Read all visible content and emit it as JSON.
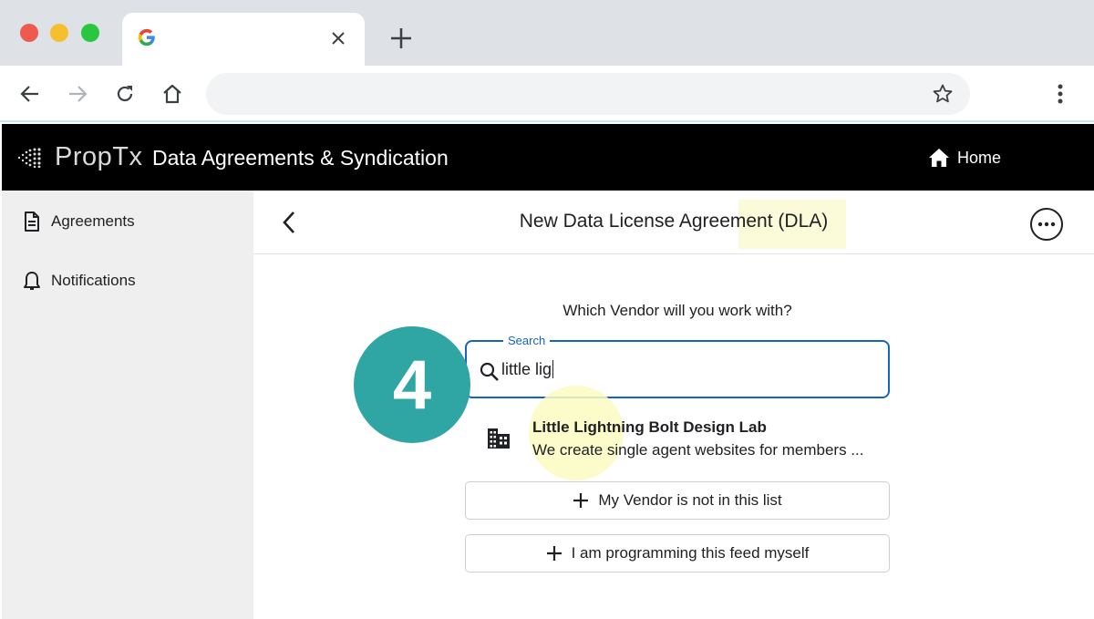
{
  "browser": {
    "tab": {
      "title": "",
      "favicon": "google-g-icon"
    },
    "address": {
      "value": ""
    }
  },
  "header": {
    "logo": "PropTx",
    "title": "Data Agreements & Syndication",
    "home_label": "Home"
  },
  "sidebar": {
    "items": [
      {
        "label": "Agreements",
        "icon": "document-icon"
      },
      {
        "label": "Notifications",
        "icon": "bell-icon"
      }
    ]
  },
  "main": {
    "title": "New Data License Agreement (DLA)",
    "question": "Which Vendor will you work with?",
    "search": {
      "legend": "Search",
      "value": "little lig"
    },
    "step_number": "4",
    "result": {
      "name": "Little Lightning Bolt Design Lab",
      "description": "We create single agent websites for members ..."
    },
    "options": [
      {
        "label": "My Vendor is not in this list"
      },
      {
        "label": "I am programming this feed myself"
      }
    ]
  },
  "colors": {
    "accent": "#1565c0",
    "step_badge": "#2fa6a3",
    "header_bg": "#000000",
    "sidebar_bg": "#efefef"
  }
}
